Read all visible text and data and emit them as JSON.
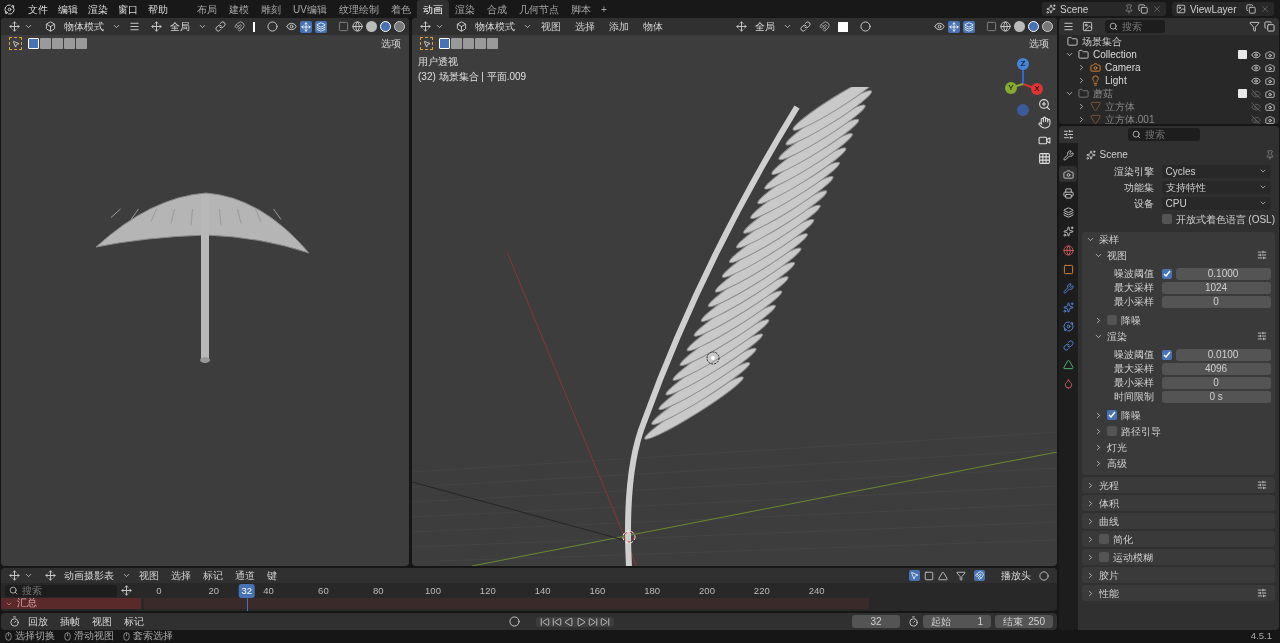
{
  "menu": [
    "文件",
    "编辑",
    "渲染",
    "窗口",
    "帮助"
  ],
  "workspaces": [
    {
      "label": "布局",
      "selected": false
    },
    {
      "label": "建模",
      "selected": false
    },
    {
      "label": "雕刻",
      "selected": false
    },
    {
      "label": "UV编辑",
      "selected": false
    },
    {
      "label": "纹理绘制",
      "selected": false
    },
    {
      "label": "着色",
      "selected": false
    },
    {
      "label": "动画",
      "selected": true
    },
    {
      "label": "渲染",
      "selected": false
    },
    {
      "label": "合成",
      "selected": false
    },
    {
      "label": "几何节点",
      "selected": false
    },
    {
      "label": "脚本",
      "selected": false
    }
  ],
  "add_workspace": "+",
  "scene": "Scene",
  "view_layer": "ViewLayer",
  "left_viewport": {
    "mode": "物体模式",
    "orientation": "全局",
    "options": "选项"
  },
  "main_viewport": {
    "mode": "物体模式",
    "menus": [
      "视图",
      "选择",
      "添加",
      "物体"
    ],
    "orientation": "全局",
    "options": "选项",
    "view_name": "用户透视",
    "object_info": "(32) 场景集合 | 平面.009",
    "gizmo_axes": [
      "X",
      "Y",
      "Z"
    ]
  },
  "outliner": {
    "search_placeholder": "搜索",
    "root": "场景集合",
    "items": [
      {
        "kind": "collection",
        "label": "Collection",
        "expanded": true,
        "checked": true,
        "visible": true,
        "children": [
          {
            "kind": "camera",
            "label": "Camera",
            "expanded": false,
            "visible": true
          },
          {
            "kind": "light",
            "label": "Light",
            "expanded": false,
            "visible": true
          }
        ]
      },
      {
        "kind": "collection",
        "label": "蘑菇",
        "expanded": true,
        "checked": true,
        "visible": false,
        "children": [
          {
            "kind": "mesh",
            "label": "立方体",
            "expanded": false,
            "visible": false
          },
          {
            "kind": "mesh",
            "label": "立方体.001",
            "expanded": false,
            "visible": false
          }
        ]
      }
    ]
  },
  "properties": {
    "search_placeholder": "搜索",
    "context": "Scene",
    "tabs": [
      {
        "kind": "tool",
        "selected": false
      },
      {
        "kind": "render",
        "selected": true
      },
      {
        "kind": "output",
        "selected": false
      },
      {
        "kind": "view_layer",
        "selected": false
      },
      {
        "kind": "scene",
        "selected": false
      },
      {
        "kind": "world",
        "selected": false
      },
      {
        "kind": "object",
        "selected": false
      },
      {
        "kind": "modifier",
        "selected": false
      },
      {
        "kind": "particles",
        "selected": false
      },
      {
        "kind": "physics",
        "selected": false
      },
      {
        "kind": "constraints",
        "selected": false
      },
      {
        "kind": "data",
        "selected": false
      },
      {
        "kind": "material",
        "selected": false
      }
    ],
    "fields": [
      {
        "label": "渲染引擎",
        "value": "Cycles"
      },
      {
        "label": "功能集",
        "value": "支持特性"
      },
      {
        "label": "设备",
        "value": "CPU"
      }
    ],
    "osl": {
      "label": "开放式着色语言 (OSL)",
      "checked": false
    },
    "sampling": {
      "label": "采样",
      "expanded": true,
      "subpanels": [
        {
          "kind": "group",
          "label": "视图",
          "expanded": true,
          "rows": [
            {
              "label": "噪波阈值",
              "checked": true,
              "value": "0.1000"
            },
            {
              "label": "最大采样",
              "value": "1024"
            },
            {
              "label": "最小采样",
              "value": "0"
            }
          ]
        },
        {
          "kind": "toggle",
          "label": "降噪",
          "expanded": false,
          "checked": false
        },
        {
          "kind": "group",
          "label": "渲染",
          "expanded": true,
          "rows": [
            {
              "label": "噪波阈值",
              "checked": true,
              "value": "0.0100"
            },
            {
              "label": "最大采样",
              "value": "4096"
            },
            {
              "label": "最小采样",
              "value": "0"
            },
            {
              "label": "时间限制",
              "value": "0 s"
            }
          ]
        },
        {
          "kind": "toggle",
          "label": "降噪",
          "expanded": false,
          "checked": true
        },
        {
          "kind": "toggle",
          "label": "路径引导",
          "expanded": false,
          "checked": false
        },
        {
          "kind": "plain",
          "label": "灯光",
          "expanded": false
        },
        {
          "kind": "plain",
          "label": "高级",
          "expanded": false
        }
      ]
    },
    "panels": [
      {
        "kind": "presets",
        "label": "光程"
      },
      {
        "kind": "plain",
        "label": "体积"
      },
      {
        "kind": "plain",
        "label": "曲线"
      },
      {
        "kind": "toggle",
        "label": "简化",
        "checked": false
      },
      {
        "kind": "toggle",
        "label": "运动模糊",
        "checked": false
      },
      {
        "kind": "plain",
        "label": "胶片"
      },
      {
        "kind": "presets",
        "label": "性能"
      }
    ]
  },
  "timeline": {
    "editor": "动画摄影表",
    "menus": [
      "视图",
      "选择",
      "标记",
      "通道",
      "键"
    ],
    "search_placeholder": "搜索",
    "ticks": [
      "0",
      "20",
      "40",
      "60",
      "80",
      "100",
      "120",
      "140",
      "160",
      "180",
      "200",
      "220",
      "240"
    ],
    "current_frame": "32",
    "summary": "汇总",
    "playhead": "播放头"
  },
  "playback": {
    "menus": [
      "回放",
      "插帧",
      "视图",
      "标记"
    ],
    "frame": "32",
    "start_label": "起始",
    "start": "1",
    "end_label": "结束",
    "end": "250"
  },
  "status_bar": {
    "hints": [
      "选择切换",
      "滑动视图",
      "套索选择"
    ],
    "version": "4.5.1"
  }
}
